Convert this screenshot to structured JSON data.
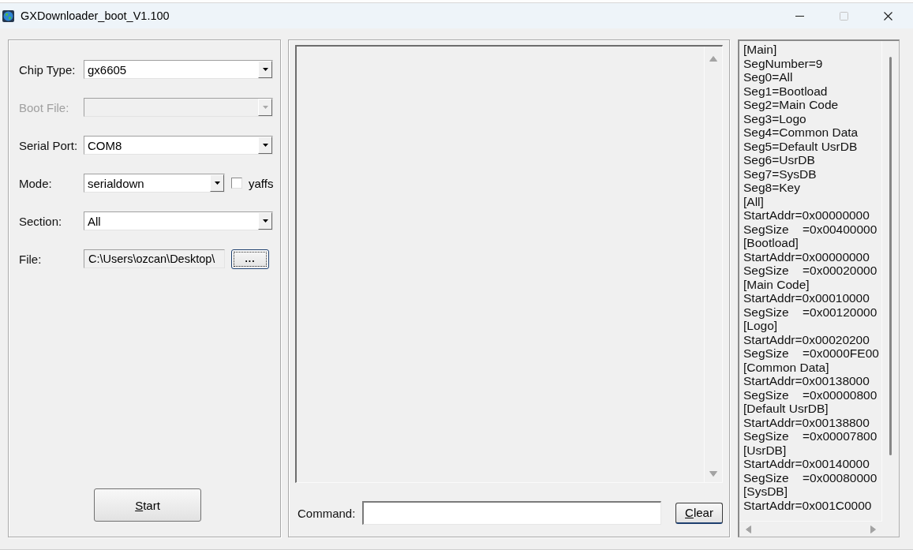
{
  "window": {
    "title": "GXDownloader_boot_V1.100",
    "controls": [
      {
        "kind": "minimize",
        "disabled": false
      },
      {
        "kind": "maximize",
        "disabled": true
      },
      {
        "kind": "close",
        "disabled": false
      }
    ]
  },
  "settings": {
    "fields": [
      {
        "kind": "combo",
        "label": "Chip Type:",
        "value": "gx6605",
        "disabled": false
      },
      {
        "kind": "combo",
        "label": "Boot File:",
        "disabled": true
      },
      {
        "kind": "combo",
        "label": "Serial Port:",
        "value": "COM8",
        "disabled": false
      },
      {
        "kind": "combo",
        "label": "Mode:",
        "value": "serialdown",
        "disabled": false,
        "checkbox": {
          "label": "yaffs",
          "checked": false
        }
      },
      {
        "kind": "combo",
        "label": "Section:",
        "value": "All",
        "disabled": false
      },
      {
        "kind": "file",
        "label": "File:",
        "value": "C:\\Users\\ozcan\\Desktop\\",
        "button": "..."
      }
    ],
    "start_button": "Start"
  },
  "console": {
    "command_label": "Command:",
    "clear_button": "Clear"
  },
  "config_text": {
    "lines": [
      "[Main]",
      "SegNumber=9",
      "Seg0=All",
      "Seg1=Bootload",
      "Seg2=Main Code",
      "Seg3=Logo",
      "Seg4=Common Data",
      "Seg5=Default UsrDB",
      "Seg6=UsrDB",
      "Seg7=SysDB",
      "Seg8=Key",
      "[All]",
      "StartAddr=0x00000000",
      "SegSize    =0x00400000",
      "[Bootload]",
      "StartAddr=0x00000000",
      "SegSize    =0x00020000",
      "[Main Code]",
      "StartAddr=0x00010000",
      "SegSize    =0x00120000",
      "[Logo]",
      "StartAddr=0x00020200",
      "SegSize    =0x0000FE00",
      "[Common Data]",
      "StartAddr=0x00138000",
      "SegSize    =0x00000800",
      "[Default UsrDB]",
      "StartAddr=0x00138800",
      "SegSize    =0x00007800",
      "[UsrDB]",
      "StartAddr=0x00140000",
      "SegSize    =0x00080000",
      "[SysDB]",
      "StartAddr=0x001C0000"
    ]
  }
}
